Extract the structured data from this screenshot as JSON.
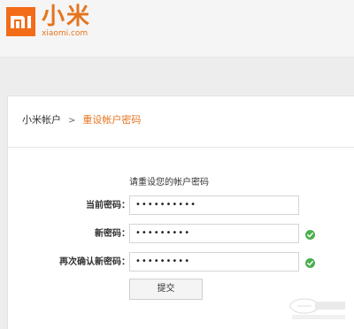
{
  "header": {
    "logo_icon": "mi-logo-icon",
    "brand_name": "小米",
    "brand_domain": "xiaomi.com",
    "accent_color": "#f26c1a"
  },
  "breadcrumb": {
    "home": "小米帐户",
    "separator": ">",
    "current": "重设帐户密码"
  },
  "form": {
    "title": "请重设您的帐户密码",
    "fields": [
      {
        "label": "当前密码：",
        "value": "••••••••••",
        "status_icon": null
      },
      {
        "label": "新密码：",
        "value": "•••••••••",
        "status_icon": "check-circle-icon"
      },
      {
        "label": "再次确认新密码：",
        "value": "•••••••••",
        "status_icon": "check-circle-icon"
      }
    ],
    "submit_label": "提交"
  },
  "colors": {
    "brand_orange": "#e5741d",
    "valid_green": "#4caf50"
  },
  "watermark": {
    "icon": "pconline-watermark-logo"
  }
}
